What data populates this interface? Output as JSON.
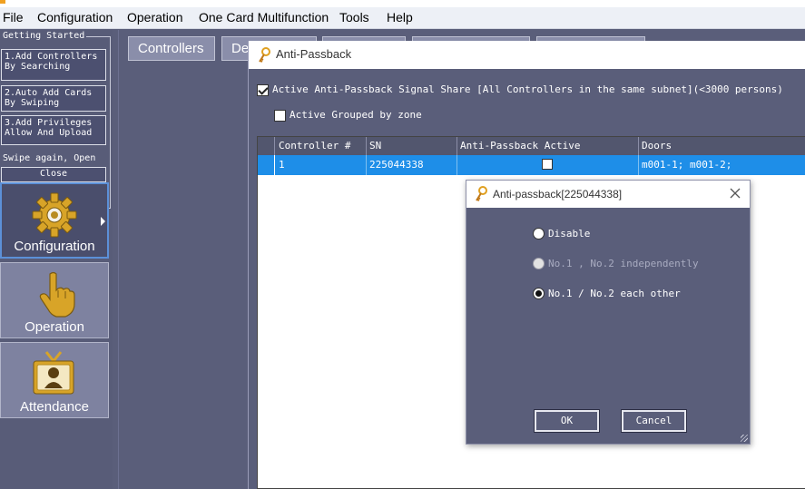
{
  "menubar": {
    "items": [
      {
        "label": "File"
      },
      {
        "label": "Configuration"
      },
      {
        "label": "Operation"
      },
      {
        "label": "One Card Multifunction"
      },
      {
        "label": "Tools"
      },
      {
        "label": "Help"
      }
    ]
  },
  "sidebar": {
    "getting_started": {
      "legend": "Getting Started",
      "steps": [
        {
          "line1": "1.Add Controllers",
          "line2": "By Searching"
        },
        {
          "line1": "2.Auto Add Cards",
          "line2": "By Swiping"
        },
        {
          "line1": "3.Add Privileges",
          "line2": "Allow And Upload"
        }
      ],
      "hint": "Swipe again, Open",
      "close_label": "Close"
    },
    "nav": [
      {
        "label": "Configuration",
        "icon": "gear-icon",
        "active": true
      },
      {
        "label": "Operation",
        "icon": "hand-pointer-icon",
        "active": false
      },
      {
        "label": "Attendance",
        "icon": "id-badge-icon",
        "active": false
      }
    ]
  },
  "toolbar": {
    "tabs": [
      {
        "label": "Controllers"
      },
      {
        "label": "De"
      },
      {
        "label": ""
      },
      {
        "label": ""
      },
      {
        "label": ""
      }
    ]
  },
  "ap_window": {
    "title": "Anti-Passback",
    "signal_share": {
      "label": "Active Anti-Passback Signal Share [All Controllers in the same subnet](<3000 persons)",
      "checked": true
    },
    "grouped_by_zone": {
      "label": "Active Grouped by zone",
      "checked": false
    },
    "grid": {
      "columns": [
        "Controller #",
        "SN",
        "Anti-Passback Active",
        "Doors"
      ],
      "rows": [
        {
          "controller": "1",
          "sn": "225044338",
          "active": false,
          "doors": "m001-1;   m001-2;"
        }
      ]
    }
  },
  "dialog": {
    "title": "Anti-passback[225044338]",
    "options": [
      {
        "label": "Disable",
        "selected": false,
        "enabled": true
      },
      {
        "label": "No.1 , No.2 independently",
        "selected": false,
        "enabled": false
      },
      {
        "label": "No.1 / No.2 each other",
        "selected": true,
        "enabled": true
      }
    ],
    "ok_label": "OK",
    "cancel_label": "Cancel"
  },
  "colors": {
    "background": "#5a5e7a",
    "selection": "#1e8ee8",
    "nav_active_border": "#5c90d8",
    "icon_gold": "#d8a428"
  }
}
